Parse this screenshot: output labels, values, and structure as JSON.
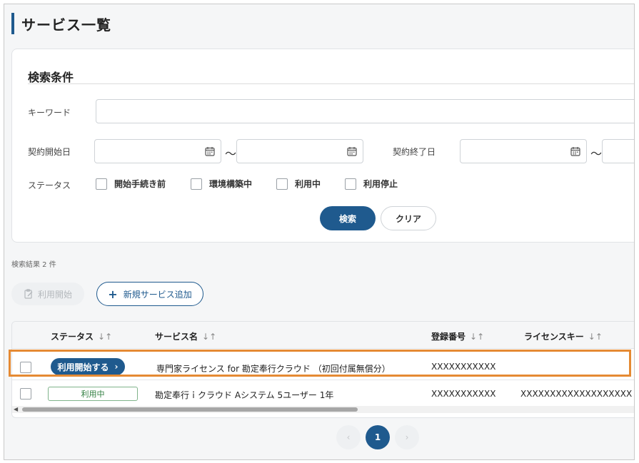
{
  "page": {
    "title": "サービス一覧"
  },
  "search": {
    "section_title": "検索条件",
    "keyword_label": "キーワード",
    "keyword_value": "",
    "start_date_label": "契約開始日",
    "end_date_label": "契約終了日",
    "range_sep": "〜",
    "status_label": "ステータス",
    "status_options": [
      {
        "label": "開始手続き前",
        "checked": false
      },
      {
        "label": "環境構築中",
        "checked": false
      },
      {
        "label": "利用中",
        "checked": false
      },
      {
        "label": "利用停止",
        "checked": false
      }
    ],
    "search_button": "検索",
    "clear_button": "クリア"
  },
  "results": {
    "count_text": "検索結果 2 件",
    "start_use_button": "利用開始",
    "add_service_button": "新規サービス追加"
  },
  "table": {
    "columns": [
      "ステータス",
      "サービス名",
      "登録番号",
      "ライセンスキー"
    ],
    "sort_glyph": "↓↑",
    "rows": [
      {
        "status": "利用開始する",
        "status_type": "action",
        "service": "専門家ライセンス for 勘定奉行クラウド （初回付属無償分）",
        "reg_no": "XXXXXXXXXXX",
        "license": ""
      },
      {
        "status": "利用中",
        "status_type": "in-use",
        "service": "勘定奉行ｉクラウド Aシステム 5ユーザー 1年",
        "reg_no": "XXXXXXXXXXX",
        "license": "XXXXXXXXXXXXXXXXXXX"
      }
    ]
  },
  "pagination": {
    "prev": "‹",
    "current": "1",
    "next": "›"
  },
  "colors": {
    "primary": "#1f5a8e",
    "highlight": "#e58a33",
    "in_use": "#2f7d3f"
  }
}
